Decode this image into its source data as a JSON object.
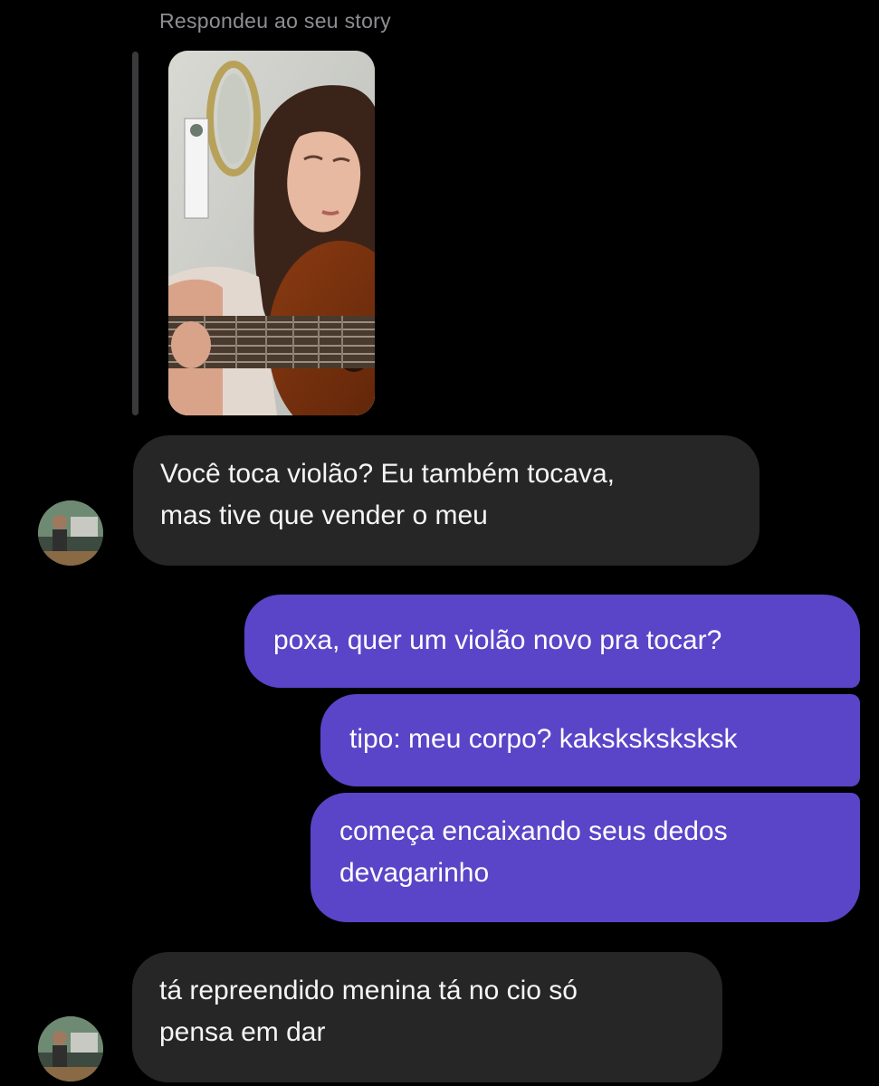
{
  "story_reply": {
    "label": "Respondeu ao seu story"
  },
  "messages": [
    {
      "direction": "incoming",
      "text": "Você toca violão? Eu também tocava,\nmas tive que vender o meu"
    },
    {
      "direction": "outgoing",
      "text": "poxa, quer um violão novo pra tocar?"
    },
    {
      "direction": "outgoing",
      "text": "tipo: meu corpo? kaksksksksksk"
    },
    {
      "direction": "outgoing",
      "text": "começa encaixando seus dedos\ndevagarinho"
    },
    {
      "direction": "incoming",
      "text": "tá repreendido menina tá no cio só\npensa em dar"
    }
  ],
  "colors": {
    "background": "#000000",
    "incoming_bubble": "#262626",
    "outgoing_bubble": "#5a45c8",
    "meta_text": "#8e8e93"
  }
}
